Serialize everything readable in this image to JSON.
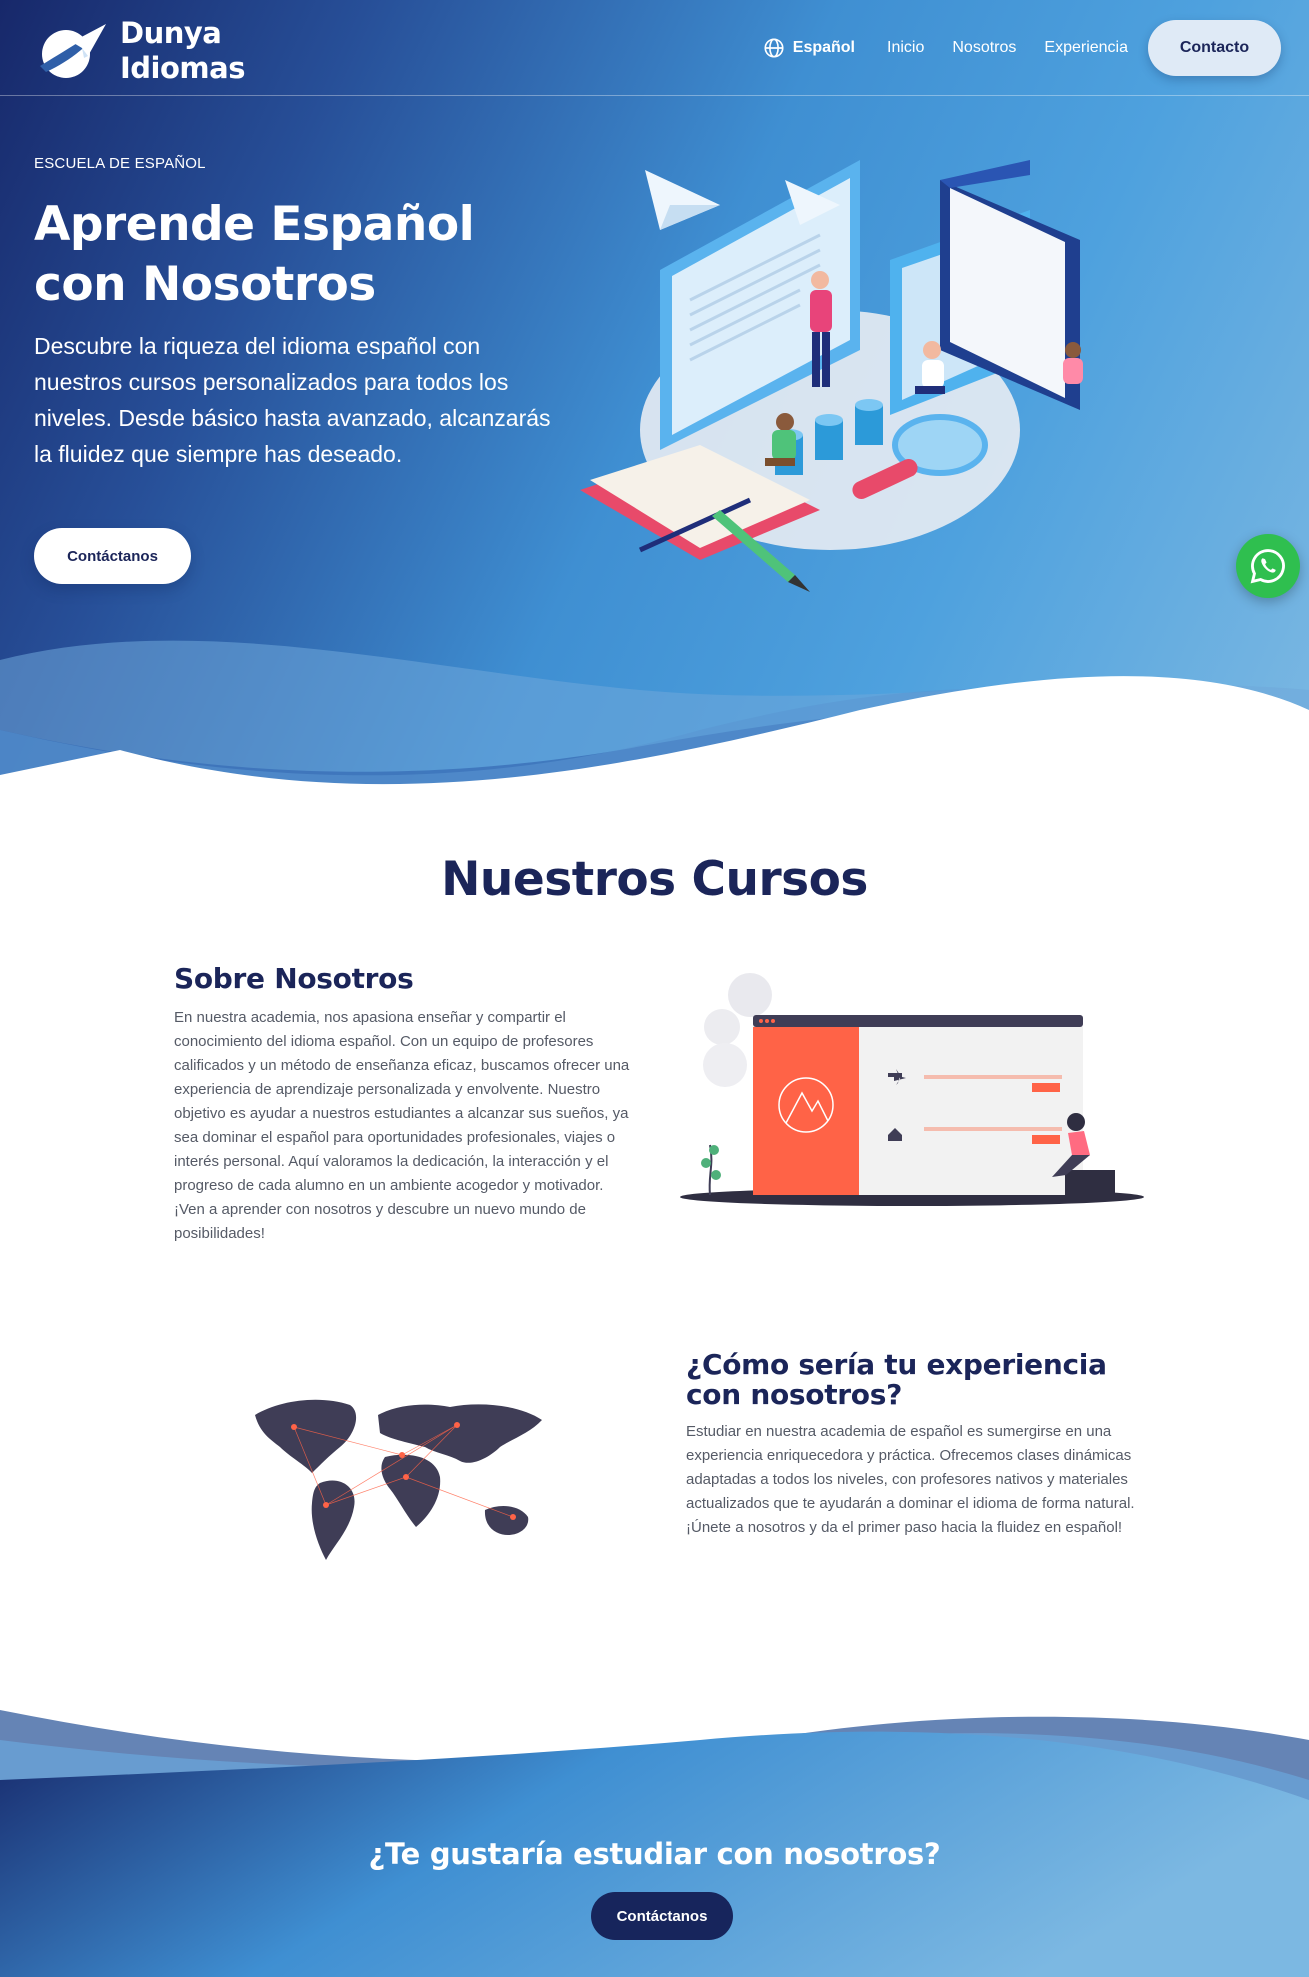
{
  "brand": {
    "line1": "Dunya",
    "line2": "Idiomas"
  },
  "nav": {
    "language": "Español",
    "links": [
      "Inicio",
      "Nosotros",
      "Experiencia"
    ],
    "cta": "Contacto"
  },
  "hero": {
    "eyebrow": "ESCUELA DE ESPAÑOL",
    "title": "Aprende Español con Nosotros",
    "description": "Descubre la riqueza del idioma español con nuestros cursos personalizados para todos los niveles. Desde básico hasta avanzado, alcanzarás la fluidez que siempre has deseado.",
    "button": "Contáctanos"
  },
  "courses": {
    "title": "Nuestros Cursos",
    "about": {
      "title": "Sobre Nosotros",
      "text": "En nuestra academia, nos apasiona enseñar y compartir el conocimiento del idioma español. Con un equipo de profesores calificados y un método de enseñanza eficaz, buscamos ofrecer una experiencia de aprendizaje personalizada y envolvente. Nuestro objetivo es ayudar a nuestros estudiantes a alcanzar sus sueños, ya sea dominar el español para oportunidades profesionales, viajes o interés personal. Aquí valoramos la dedicación, la interacción y el progreso de cada alumno en un ambiente acogedor y motivador. ¡Ven a aprender con nosotros y descubre un nuevo mundo de posibilidades!"
    },
    "experience": {
      "title": "¿Cómo sería tu experiencia con nosotros?",
      "text": "Estudiar en nuestra academia de español es sumergirse en una experiencia enriquecedora y práctica. Ofrecemos clases dinámicas adaptadas a todos los niveles, con profesores nativos y materiales actualizados que te ayudarán a dominar el idioma de forma natural. ¡Únete a nosotros y da el primer paso hacia la fluidez en español!"
    }
  },
  "cta": {
    "title": "¿Te gustaría estudiar con nosotros?",
    "button": "Contáctanos"
  },
  "colors": {
    "navy": "#1b2559",
    "accent_orange": "#ff6347",
    "whatsapp": "#2fbf4f",
    "gradient_start": "#17286a",
    "gradient_end": "#7cb8e2"
  },
  "icons": [
    "plane-logo-icon",
    "globe-icon",
    "whatsapp-icon"
  ]
}
